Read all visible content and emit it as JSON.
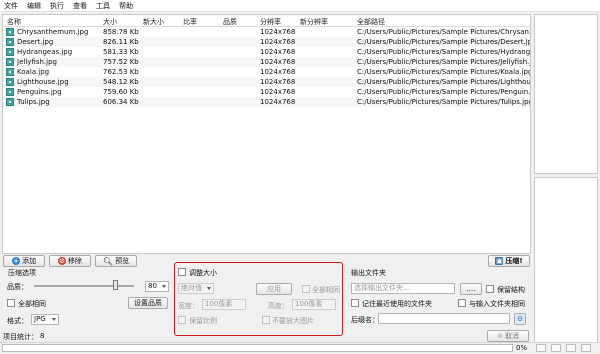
{
  "menu": [
    "文件",
    "编辑",
    "执行",
    "查看",
    "工具",
    "帮助"
  ],
  "table": {
    "headers": [
      "名称",
      "大小",
      "新大小",
      "比率",
      "品质",
      "分辨率",
      "新分辨率",
      "全部路径"
    ],
    "rows": [
      {
        "name": "Chrysanthemum.jpg",
        "size": "858.78 Kb",
        "res": "1024x768",
        "path": "C:/Users/Public/Pictures/Sample Pictures/Chrysan..."
      },
      {
        "name": "Desert.jpg",
        "size": "826.11 Kb",
        "res": "1024x768",
        "path": "C:/Users/Public/Pictures/Sample Pictures/Desert.jpg"
      },
      {
        "name": "Hydrangeas.jpg",
        "size": "581.33 Kb",
        "res": "1024x768",
        "path": "C:/Users/Public/Pictures/Sample Pictures/Hydrang..."
      },
      {
        "name": "Jellyfish.jpg",
        "size": "757.52 Kb",
        "res": "1024x768",
        "path": "C:/Users/Public/Pictures/Sample Pictures/Jellyfish.j..."
      },
      {
        "name": "Koala.jpg",
        "size": "762.53 Kb",
        "res": "1024x768",
        "path": "C:/Users/Public/Pictures/Sample Pictures/Koala.jpg"
      },
      {
        "name": "Lighthouse.jpg",
        "size": "548.12 Kb",
        "res": "1024x768",
        "path": "C:/Users/Public/Pictures/Sample Pictures/Lighthou..."
      },
      {
        "name": "Penguins.jpg",
        "size": "759.60 Kb",
        "res": "1024x768",
        "path": "C:/Users/Public/Pictures/Sample Pictures/Penguin..."
      },
      {
        "name": "Tulips.jpg",
        "size": "606.34 Kb",
        "res": "1024x768",
        "path": "C:/Users/Public/Pictures/Sample Pictures/Tulips.jpg"
      }
    ]
  },
  "toolbar": {
    "add": "添加",
    "remove": "移除",
    "preview": "预览",
    "compress": "压缩!"
  },
  "compress_options": {
    "title": "压缩选项",
    "quality_label": "品质：",
    "quality_value": "80",
    "all_same": "全部相同",
    "set_quality": "设置品质",
    "format_label": "格式：",
    "format_value": "JPG"
  },
  "resize": {
    "title": "调整大小",
    "mode": "绝对值",
    "apply": "应用",
    "all_same": "全部相同",
    "width_label": "宽度：",
    "width_placeholder": "100像素",
    "height_label": "高度：",
    "height_placeholder": "100像素",
    "keep_ratio": "保留比例",
    "no_enlarge": "不要放大图片"
  },
  "output": {
    "title": "输出文件夹",
    "placeholder": "选择输出文件夹...",
    "browse": "....",
    "keep_structure": "保留结构",
    "remember_recent": "记住最近使用的文件夹",
    "same_as_input": "与输入文件夹相同",
    "suffix_label": "后缀名："
  },
  "status": {
    "project_stats_label": "项目统计：",
    "project_stats_value": "8",
    "cancel": "取消",
    "percent": "0%"
  },
  "colors": {
    "accent_red": "#d11a1a",
    "file_icon": "#3fa7a0",
    "add_icon": "#2a7fd1",
    "remove_icon": "#d63a2a",
    "compress_icon": "#3a6fb8"
  }
}
